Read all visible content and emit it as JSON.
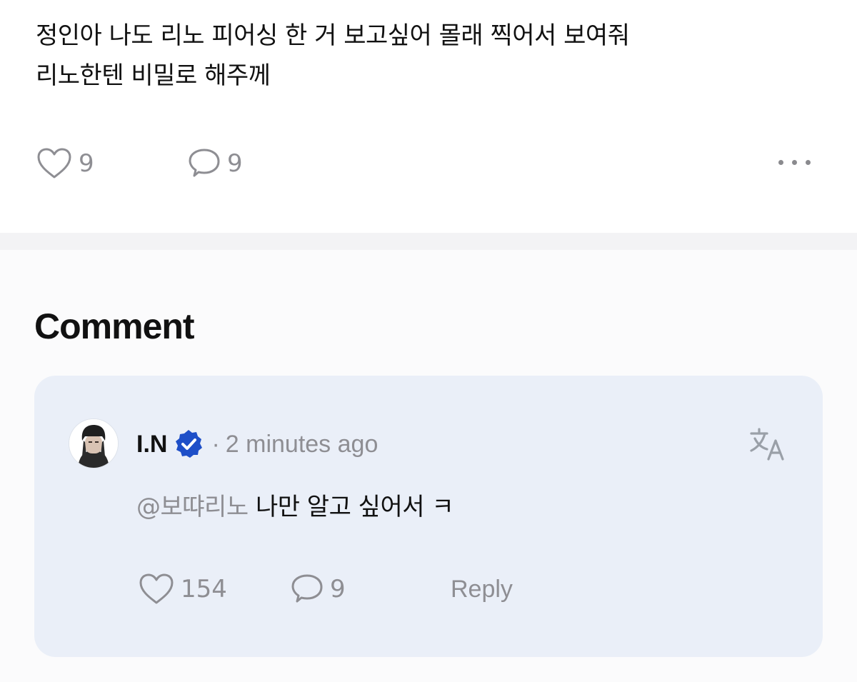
{
  "post": {
    "text_lines": [
      "정인아 나도 리노 피어싱 한 거 보고싶어 몰래 찍어서 보여줘",
      "리노한텐 비밀로 해주께"
    ],
    "like_count": "9",
    "comment_count": "9",
    "icons": {
      "like": "heart-outline-icon",
      "comment": "speech-bubble-icon",
      "more": "more-horizontal-icon"
    }
  },
  "comments_section": {
    "title": "Comment"
  },
  "comment": {
    "author": "I.N",
    "separator": "·",
    "timestamp": "2 minutes ago",
    "mention": "@보땨리노",
    "text": "나만 알고 싶어서 ㅋ",
    "like_count": "154",
    "reply_count": "9",
    "reply_label": "Reply",
    "icons": {
      "verified": "verified-badge-icon",
      "translate": "translate-icon",
      "like": "heart-outline-icon",
      "comment": "speech-bubble-icon"
    }
  },
  "colors": {
    "page_background": "#fbfbfc",
    "post_background": "#ffffff",
    "comment_card_background": "#eaeff8",
    "muted_text": "#8e8e93",
    "primary_text": "#111111",
    "verified_blue": "#1e4fc8"
  }
}
